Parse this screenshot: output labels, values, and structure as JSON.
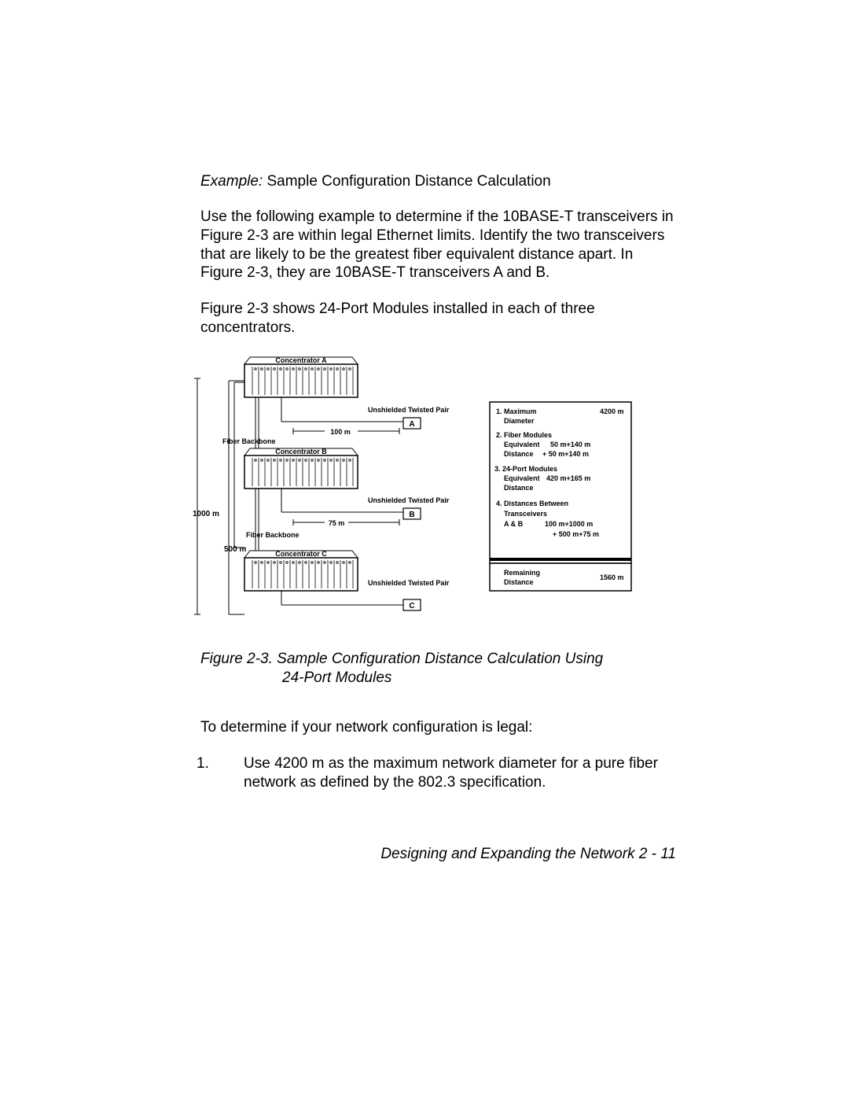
{
  "heading": {
    "lead": "Example:",
    "rest": "  Sample Configuration Distance Calculation"
  },
  "para1": "Use the following example to determine if the 10BASE-T transceivers in Figure 2-3 are within legal Ethernet limits.  Identify the two transceivers that are likely to be the greatest fiber equivalent distance apart.  In Figure 2-3, they are 10BASE-T transceivers A and B.",
  "para2": "Figure 2-3 shows 24-Port Modules installed in each of three concentrators.",
  "caption_line1": "Figure 2-3.  Sample Configuration Distance Calculation Using",
  "caption_line2": "24-Port Modules",
  "para3": "To determine if your network configuration is legal:",
  "list_item1_num": "1.",
  "list_item1_text": "Use 4200 m as the maximum network diameter for a pure fiber network as defined by the 802.3 specification.",
  "footer": "Designing and Expanding the Network  2 - 11",
  "fig": {
    "conc_a": "Concentrator A",
    "conc_b": "Concentrator B",
    "conc_c": "Concentrator C",
    "utp": "Unshielded Twisted Pair",
    "fiber": "Fiber Backbone",
    "d100": "100 m",
    "d75": "75 m",
    "d1000": "1000 m",
    "d500": "500 m",
    "box_a": "A",
    "box_b": "B",
    "box_c": "C",
    "tbl": {
      "r1a": "1. Maximum",
      "r1b": "Diameter",
      "r1v": "4200 m",
      "r2a": "2. Fiber Modules",
      "r2b": "Equivalent",
      "r2c": "Distance",
      "r2v1": "50 m+140 m",
      "r2v2": "+ 50 m+140 m",
      "r3a": "3. 24-Port Modules",
      "r3b": "Equivalent",
      "r3c": "Distance",
      "r3v1": "420 m+165 m",
      "r4a": "4. Distances Between",
      "r4b": "Transceivers",
      "r4c": "A & B",
      "r4v1": "100 m+1000 m",
      "r4v2": "+ 500 m+75 m",
      "r5a": "Remaining",
      "r5b": "Distance",
      "r5v": "1560 m"
    }
  }
}
